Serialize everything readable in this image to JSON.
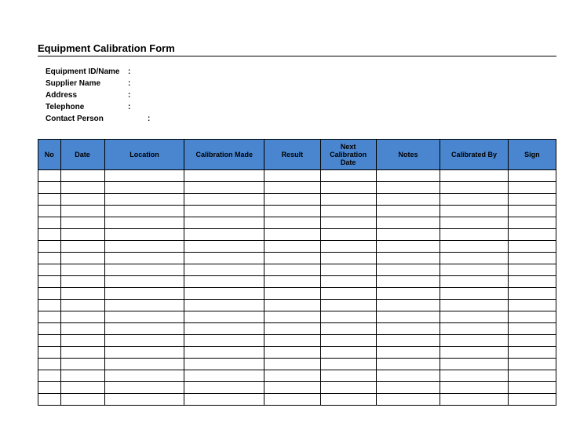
{
  "title": "Equipment Calibration Form",
  "info": {
    "equipment_id_label": "Equipment ID/Name",
    "equipment_id_value": "",
    "supplier_label": "Supplier Name",
    "supplier_value": "",
    "address_label": "Address",
    "address_value": "",
    "telephone_label": "Telephone",
    "telephone_value": "",
    "contact_label": "Contact Person",
    "contact_value": ""
  },
  "columns": {
    "no": "No",
    "date": "Date",
    "location": "Location",
    "calibration_made": "Calibration Made",
    "result": "Result",
    "next_calibration": "Next Calibration Date",
    "notes": "Notes",
    "calibrated_by": "Calibrated By",
    "sign": "Sign"
  },
  "rows": [
    {
      "no": "",
      "date": "",
      "location": "",
      "calibration_made": "",
      "result": "",
      "next_calibration": "",
      "notes": "",
      "calibrated_by": "",
      "sign": ""
    },
    {
      "no": "",
      "date": "",
      "location": "",
      "calibration_made": "",
      "result": "",
      "next_calibration": "",
      "notes": "",
      "calibrated_by": "",
      "sign": ""
    },
    {
      "no": "",
      "date": "",
      "location": "",
      "calibration_made": "",
      "result": "",
      "next_calibration": "",
      "notes": "",
      "calibrated_by": "",
      "sign": ""
    },
    {
      "no": "",
      "date": "",
      "location": "",
      "calibration_made": "",
      "result": "",
      "next_calibration": "",
      "notes": "",
      "calibrated_by": "",
      "sign": ""
    },
    {
      "no": "",
      "date": "",
      "location": "",
      "calibration_made": "",
      "result": "",
      "next_calibration": "",
      "notes": "",
      "calibrated_by": "",
      "sign": ""
    },
    {
      "no": "",
      "date": "",
      "location": "",
      "calibration_made": "",
      "result": "",
      "next_calibration": "",
      "notes": "",
      "calibrated_by": "",
      "sign": ""
    },
    {
      "no": "",
      "date": "",
      "location": "",
      "calibration_made": "",
      "result": "",
      "next_calibration": "",
      "notes": "",
      "calibrated_by": "",
      "sign": ""
    },
    {
      "no": "",
      "date": "",
      "location": "",
      "calibration_made": "",
      "result": "",
      "next_calibration": "",
      "notes": "",
      "calibrated_by": "",
      "sign": ""
    },
    {
      "no": "",
      "date": "",
      "location": "",
      "calibration_made": "",
      "result": "",
      "next_calibration": "",
      "notes": "",
      "calibrated_by": "",
      "sign": ""
    },
    {
      "no": "",
      "date": "",
      "location": "",
      "calibration_made": "",
      "result": "",
      "next_calibration": "",
      "notes": "",
      "calibrated_by": "",
      "sign": ""
    },
    {
      "no": "",
      "date": "",
      "location": "",
      "calibration_made": "",
      "result": "",
      "next_calibration": "",
      "notes": "",
      "calibrated_by": "",
      "sign": ""
    },
    {
      "no": "",
      "date": "",
      "location": "",
      "calibration_made": "",
      "result": "",
      "next_calibration": "",
      "notes": "",
      "calibrated_by": "",
      "sign": ""
    },
    {
      "no": "",
      "date": "",
      "location": "",
      "calibration_made": "",
      "result": "",
      "next_calibration": "",
      "notes": "",
      "calibrated_by": "",
      "sign": ""
    },
    {
      "no": "",
      "date": "",
      "location": "",
      "calibration_made": "",
      "result": "",
      "next_calibration": "",
      "notes": "",
      "calibrated_by": "",
      "sign": ""
    },
    {
      "no": "",
      "date": "",
      "location": "",
      "calibration_made": "",
      "result": "",
      "next_calibration": "",
      "notes": "",
      "calibrated_by": "",
      "sign": ""
    },
    {
      "no": "",
      "date": "",
      "location": "",
      "calibration_made": "",
      "result": "",
      "next_calibration": "",
      "notes": "",
      "calibrated_by": "",
      "sign": ""
    },
    {
      "no": "",
      "date": "",
      "location": "",
      "calibration_made": "",
      "result": "",
      "next_calibration": "",
      "notes": "",
      "calibrated_by": "",
      "sign": ""
    },
    {
      "no": "",
      "date": "",
      "location": "",
      "calibration_made": "",
      "result": "",
      "next_calibration": "",
      "notes": "",
      "calibrated_by": "",
      "sign": ""
    },
    {
      "no": "",
      "date": "",
      "location": "",
      "calibration_made": "",
      "result": "",
      "next_calibration": "",
      "notes": "",
      "calibrated_by": "",
      "sign": ""
    },
    {
      "no": "",
      "date": "",
      "location": "",
      "calibration_made": "",
      "result": "",
      "next_calibration": "",
      "notes": "",
      "calibrated_by": "",
      "sign": ""
    }
  ]
}
